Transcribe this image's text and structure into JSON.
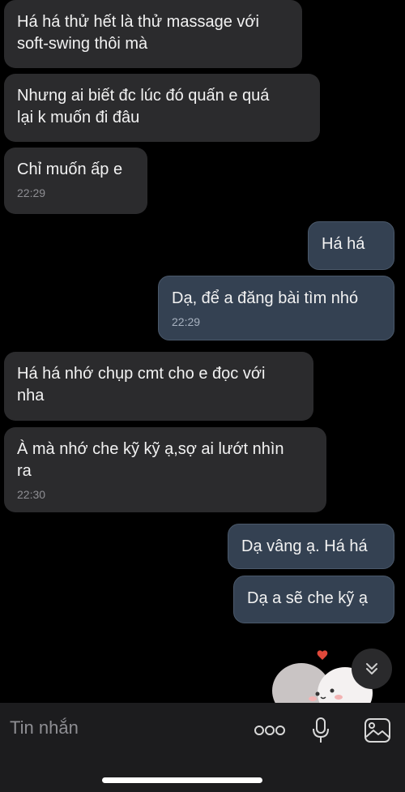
{
  "messages": [
    {
      "direction": "in",
      "text": "Há há thử hết là thử massage với\nsoft-swing thôi mà",
      "time": ""
    },
    {
      "direction": "in",
      "text": "Nhưng ai biết đc lúc đó quấn e quá\nlại k muốn đi đâu",
      "time": ""
    },
    {
      "direction": "in",
      "text": "Chỉ muốn ấp e",
      "time": "22:29"
    },
    {
      "direction": "out",
      "text": "Há há",
      "time": ""
    },
    {
      "direction": "out",
      "text": "Dạ, để a đăng bài tìm nhó",
      "time": "22:29"
    },
    {
      "direction": "in",
      "text": "Há há nhớ chụp cmt cho e đọc với\nnha",
      "time": ""
    },
    {
      "direction": "in",
      "text": "À mà nhớ che kỹ kỹ ạ,sợ ai lướt nhìn\nra",
      "time": "22:30"
    },
    {
      "direction": "out",
      "text": "Dạ vâng ạ. Há há",
      "time": ""
    },
    {
      "direction": "out",
      "text": "Dạ a sẽ che kỹ ạ",
      "time": ""
    }
  ],
  "composer": {
    "placeholder": "Tin nhắn",
    "icons": [
      "more-icon",
      "microphone-icon",
      "image-icon"
    ]
  },
  "scroll_button_icon": "chevron-double-down-icon",
  "colors": {
    "background": "#000000",
    "incoming_bubble": "#2b2b2d",
    "outgoing_bubble": "#344152",
    "composer_bar": "#1c1c1e"
  }
}
